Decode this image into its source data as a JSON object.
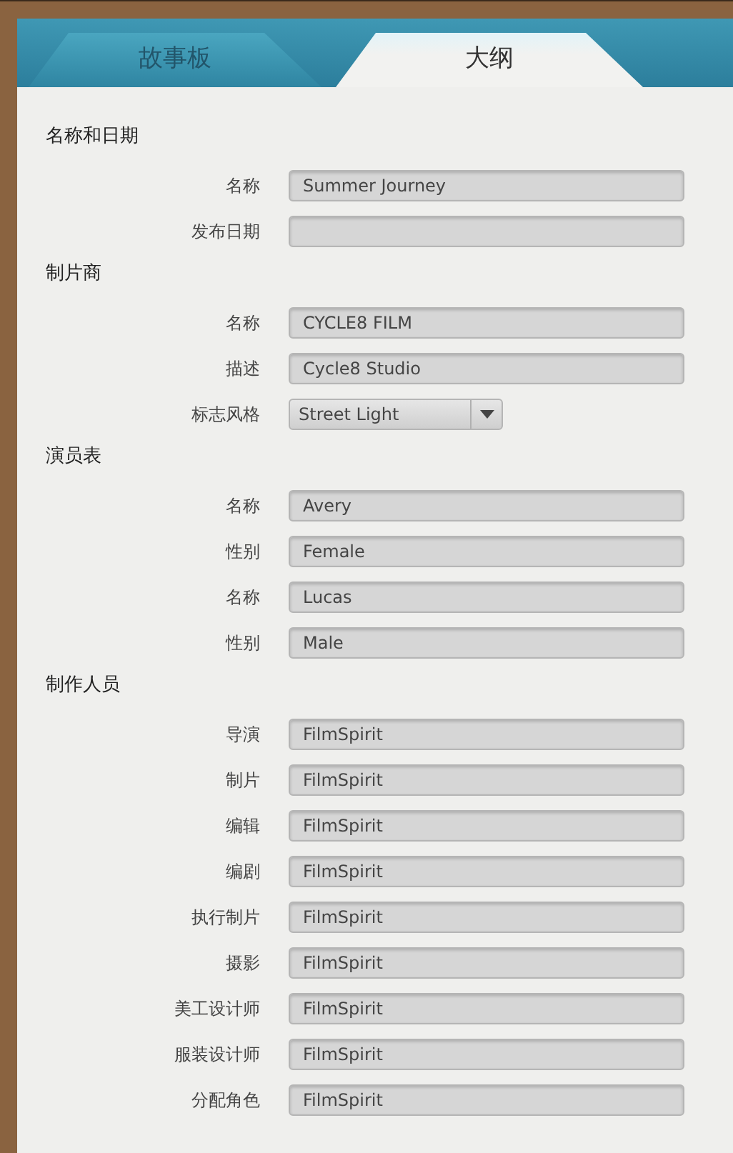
{
  "tabs": [
    {
      "label": "故事板",
      "selected": false
    },
    {
      "label": "大纲",
      "selected": true
    }
  ],
  "sections": [
    {
      "title": "名称和日期",
      "fields": [
        {
          "kind": "text",
          "label": "名称",
          "value": "Summer Journey"
        },
        {
          "kind": "text",
          "label": "发布日期"
        }
      ]
    },
    {
      "title": "制片商",
      "fields": [
        {
          "kind": "text",
          "label": "名称",
          "value": "CYCLE8 FILM"
        },
        {
          "kind": "text",
          "label": "描述",
          "value": "Cycle8 Studio"
        },
        {
          "kind": "select",
          "label": "标志风格",
          "value": "Street Light"
        }
      ]
    },
    {
      "title": "演员表",
      "fields": [
        {
          "kind": "text",
          "label": "名称",
          "value": "Avery"
        },
        {
          "kind": "text",
          "label": "性别",
          "value": "Female"
        },
        {
          "kind": "text",
          "label": "名称",
          "value": "Lucas"
        },
        {
          "kind": "text",
          "label": "性别",
          "value": "Male"
        }
      ]
    },
    {
      "title": "制作人员",
      "fields": [
        {
          "kind": "text",
          "label": "导演",
          "value": "FilmSpirit"
        },
        {
          "kind": "text",
          "label": "制片",
          "value": "FilmSpirit"
        },
        {
          "kind": "text",
          "label": "编辑",
          "value": "FilmSpirit"
        },
        {
          "kind": "text",
          "label": "编剧",
          "value": "FilmSpirit"
        },
        {
          "kind": "text",
          "label": "执行制片",
          "value": "FilmSpirit"
        },
        {
          "kind": "text",
          "label": "摄影",
          "value": "FilmSpirit"
        },
        {
          "kind": "text",
          "label": "美工设计师",
          "value": "FilmSpirit"
        },
        {
          "kind": "text",
          "label": "服装设计师",
          "value": "FilmSpirit"
        },
        {
          "kind": "text",
          "label": "分配角色",
          "value": "FilmSpirit"
        }
      ]
    }
  ]
}
